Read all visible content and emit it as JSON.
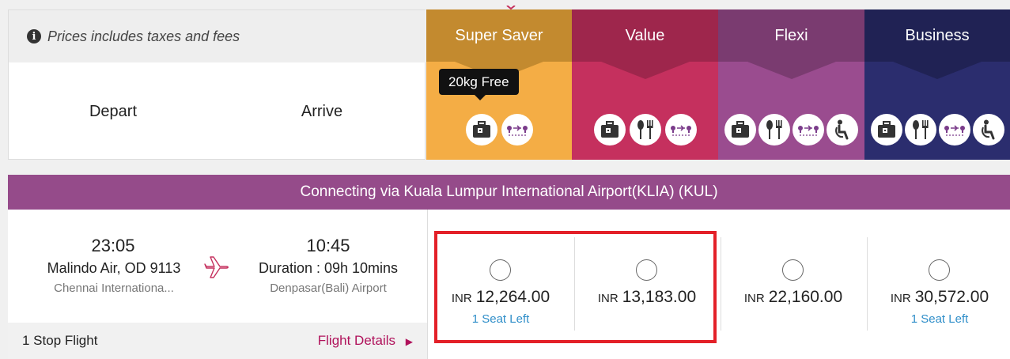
{
  "header": {
    "note": "Prices includes taxes and fees",
    "depart_label": "Depart",
    "arrive_label": "Arrive"
  },
  "fares": [
    {
      "name": "Super Saver",
      "color": "#f4ad45",
      "top_color": "#c38a2f",
      "icons": [
        "baggage-icon",
        "transit-icon"
      ]
    },
    {
      "name": "Value",
      "color": "#c5305e",
      "top_color": "#9e264c",
      "icons": [
        "baggage-icon",
        "meal-icon",
        "transit-icon"
      ]
    },
    {
      "name": "Flexi",
      "color": "#9a4c8f",
      "top_color": "#7a3b70",
      "icons": [
        "baggage-icon",
        "meal-icon",
        "transit-icon",
        "assistance-icon"
      ]
    },
    {
      "name": "Business",
      "color": "#2b2d6e",
      "top_color": "#202254",
      "icons": [
        "baggage-icon",
        "meal-icon",
        "transit-icon",
        "assistance-icon"
      ]
    }
  ],
  "tooltip": "20kg Free",
  "connecting": "Connecting via Kuala Lumpur International Airport(KLIA) (KUL)",
  "flight": {
    "depart_time": "23:05",
    "airline": "Malindo Air, OD 9113",
    "origin": "Chennai Internationa...",
    "arrive_time": "10:45",
    "duration": "Duration : 09h 10mins",
    "destination": "Denpasar(Bali) Airport",
    "stops": "1 Stop Flight",
    "details_link": "Flight Details"
  },
  "prices": [
    {
      "currency": "INR",
      "amount": "12,264.00",
      "seats": "1 Seat Left"
    },
    {
      "currency": "INR",
      "amount": "13,183.00",
      "seats": ""
    },
    {
      "currency": "INR",
      "amount": "22,160.00",
      "seats": ""
    },
    {
      "currency": "INR",
      "amount": "30,572.00",
      "seats": "1 Seat Left"
    }
  ],
  "colors": {
    "accent_link": "#b0125b",
    "seats_link": "#2f8ec9",
    "highlight": "#e32028",
    "connect_bar": "#954b8a"
  }
}
